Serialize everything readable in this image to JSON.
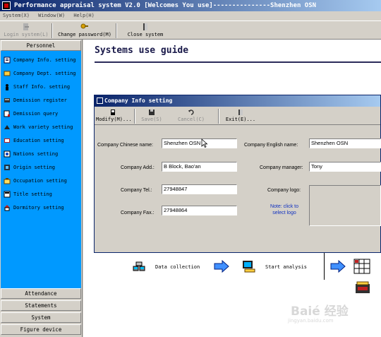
{
  "window": {
    "title": "Performance appraisal system V2.0 [Welcomes You use]---------------Shenzhen OSN"
  },
  "menu": [
    "System(X)",
    "Window(W)",
    "Help(H)"
  ],
  "toolbar": {
    "buttons": [
      {
        "label": "Login system(L)",
        "icon": "login-icon",
        "disabled": true
      },
      {
        "label": "Change password(M)",
        "icon": "key-icon",
        "disabled": false
      },
      {
        "label": "Close system",
        "icon": "exit-door-icon",
        "disabled": false
      }
    ]
  },
  "sidebar": {
    "active_group": "Personnel",
    "items": [
      {
        "label": "Company Info. setting",
        "icon": "company-info-icon"
      },
      {
        "label": "Company Dept. setting",
        "icon": "department-icon"
      },
      {
        "label": "Staff Info. setting",
        "icon": "staff-icon"
      },
      {
        "label": "Demission register",
        "icon": "register-icon"
      },
      {
        "label": "Demission query",
        "icon": "query-icon"
      },
      {
        "label": "Work variety setting",
        "icon": "work-variety-icon"
      },
      {
        "label": "Education setting",
        "icon": "education-icon"
      },
      {
        "label": "Nations setting",
        "icon": "nations-icon"
      },
      {
        "label": "Origin setting",
        "icon": "origin-icon"
      },
      {
        "label": "Occupation setting",
        "icon": "occupation-icon"
      },
      {
        "label": "Title setting",
        "icon": "title-icon"
      },
      {
        "label": "Dormitory setting",
        "icon": "dormitory-icon"
      }
    ],
    "groups": [
      "Attendance",
      "Statements",
      "System",
      "Figure device"
    ]
  },
  "main": {
    "guide_title": "Systems use guide",
    "items": [
      {
        "label": "Data collection",
        "icon": "data-collection-icon"
      },
      {
        "label": "Start analysis",
        "icon": "start-analysis-icon"
      }
    ]
  },
  "dialog": {
    "title": "Company Info setting",
    "toolbar": [
      {
        "label": "Modify(M)...",
        "icon": "modify-icon",
        "disabled": false
      },
      {
        "label": "Save(S)",
        "icon": "save-icon",
        "disabled": true
      },
      {
        "label": "Cancel(C)",
        "icon": "cancel-icon",
        "disabled": true
      },
      {
        "label": "Exit(E)...",
        "icon": "exit-icon",
        "disabled": false
      }
    ],
    "fields": {
      "chinese_name": {
        "label": "Company Chinese name:",
        "value": "Shenzhen OSN"
      },
      "english_name": {
        "label": "Company English name:",
        "value": "Shenzhen OSN"
      },
      "address": {
        "label": "Company Add.:",
        "value": "B Block, Bao'an"
      },
      "manager": {
        "label": "Company manager:",
        "value": "Tony"
      },
      "tel": {
        "label": "Company Tel.:",
        "value": "27948847"
      },
      "fax": {
        "label": "Company Fax.:",
        "value": "27948864"
      },
      "logo": {
        "label": "Company logo:"
      }
    },
    "note": "Note:   click to select logo"
  },
  "watermark": "Baié 经验",
  "watermark_sub": "jingyan.baidu.com",
  "colors": {
    "titlebar": "#0a246a",
    "nav_background": "#0099ff",
    "chrome": "#d4d0c8"
  }
}
